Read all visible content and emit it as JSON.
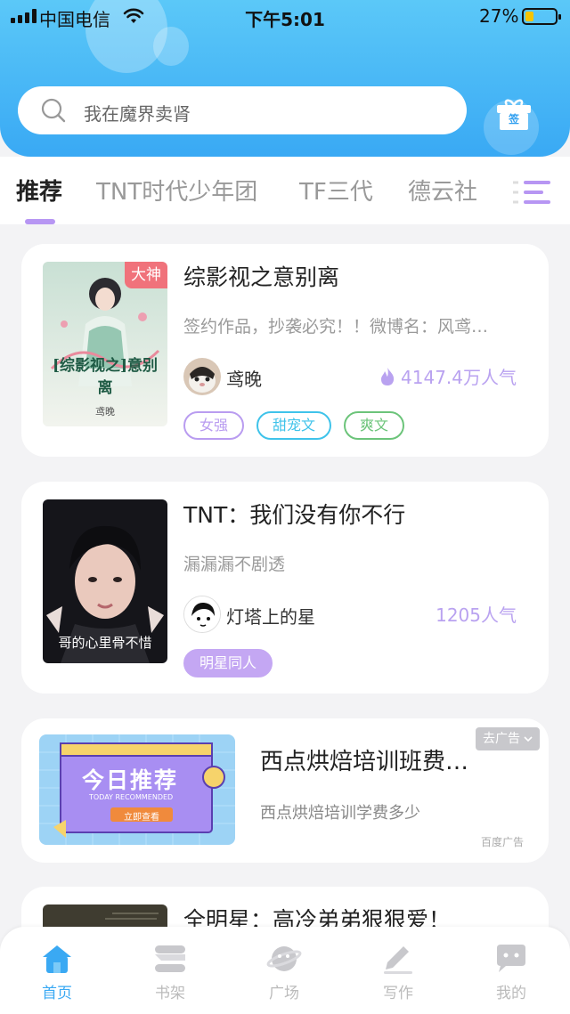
{
  "status_bar": {
    "carrier": "中国电信",
    "time": "下午5:01",
    "battery_percent": "27%",
    "battery_level": 0.27
  },
  "search": {
    "placeholder": "我在魔界卖肾"
  },
  "gift_button": {
    "label": "签"
  },
  "tabs": [
    {
      "label": "推荐",
      "active": true
    },
    {
      "label": "TNT时代少年团",
      "active": false
    },
    {
      "label": "TF三代",
      "active": false
    },
    {
      "label": "德云社",
      "active": false
    }
  ],
  "books": [
    {
      "title": "综影视之意别离",
      "badge": "大神",
      "cover_text": "[综影视之]意别离",
      "cover_author": "鸢晚",
      "description": "签约作品，抄袭必究！！微博名：风鸢…",
      "author": "鸢晚",
      "popularity": "4147.4万人气",
      "tags": [
        {
          "label": "女强",
          "color": "#b99cf0"
        },
        {
          "label": "甜宠文",
          "color": "#3fc3ea"
        },
        {
          "label": "爽文",
          "color": "#6cc47a"
        }
      ]
    },
    {
      "title": "TNT：我们没有你不行",
      "cover_caption": "哥的心里骨不惜",
      "description": "漏漏漏不剧透",
      "author": "灯塔上的星",
      "popularity": "1205人气",
      "tags": [
        {
          "label": "明星同人",
          "color": "#c4a7f3",
          "filled": true
        }
      ]
    },
    {
      "title": "全明星：高冷弟弟狠狠爱！"
    }
  ],
  "ad": {
    "title": "西点烘焙培训班费…",
    "description": "西点烘焙培训学费多少",
    "close_label": "去广告",
    "source": "百度广告",
    "image_title": "今日推荐",
    "image_subtitle": "TODAY RECOMMENDED",
    "image_button": "立即查看"
  },
  "bottom_nav": [
    {
      "label": "首页",
      "icon": "home-icon",
      "active": true
    },
    {
      "label": "书架",
      "icon": "bookshelf-icon",
      "active": false
    },
    {
      "label": "广场",
      "icon": "planet-icon",
      "active": false
    },
    {
      "label": "写作",
      "icon": "pen-icon",
      "active": false
    },
    {
      "label": "我的",
      "icon": "chat-bubble-icon",
      "active": false
    }
  ],
  "colors": {
    "header_blue": "#39a9f4",
    "accent_purple": "#b796f3",
    "nav_active": "#3aa9f3"
  }
}
